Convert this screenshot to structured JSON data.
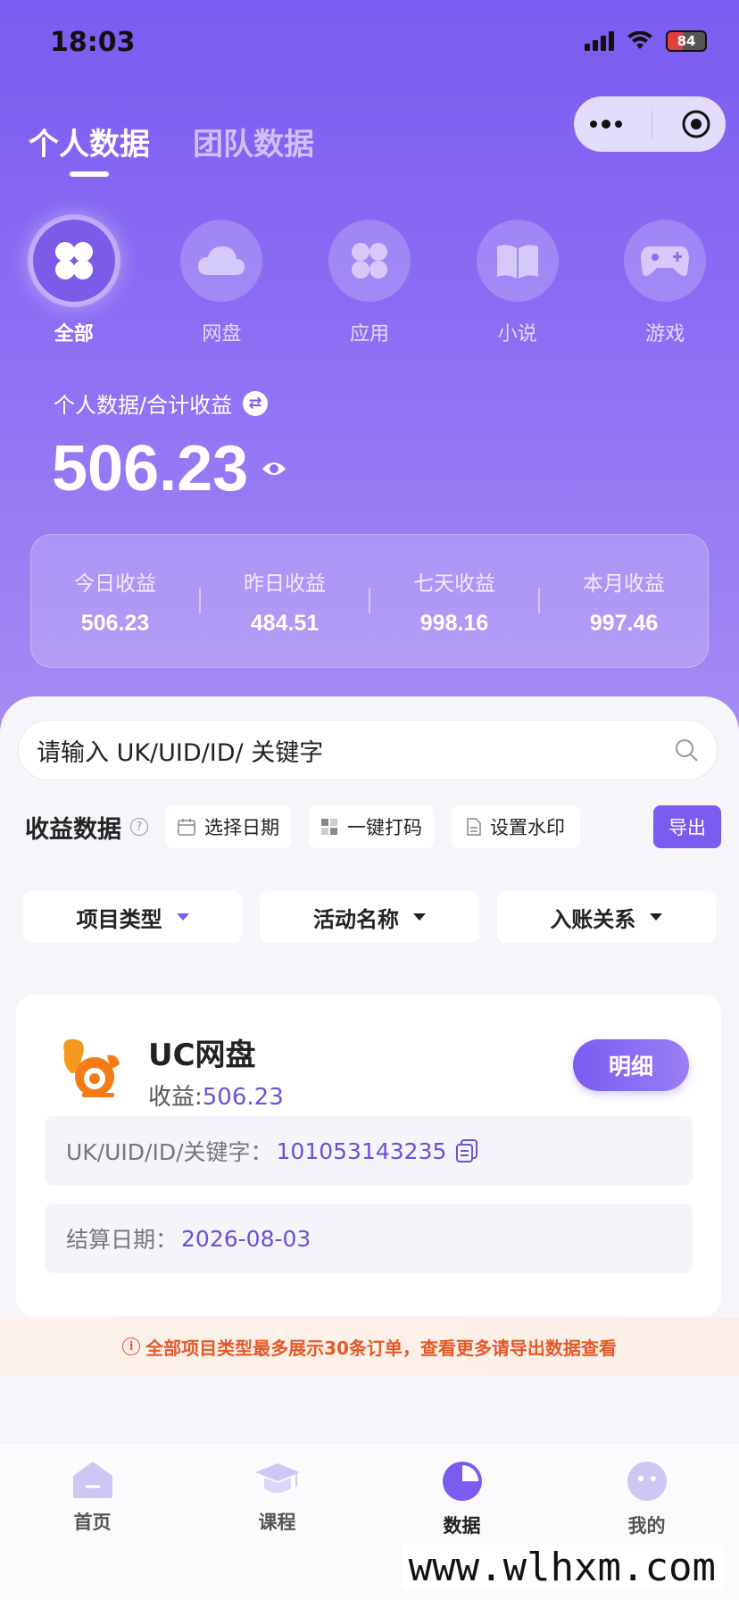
{
  "status_bar": {
    "time": "18:03",
    "battery": "84"
  },
  "tabs": {
    "personal": "个人数据",
    "team": "团队数据"
  },
  "categories": [
    {
      "label": "全部",
      "icon": "clover-icon"
    },
    {
      "label": "网盘",
      "icon": "cloud-icon"
    },
    {
      "label": "应用",
      "icon": "apps-icon"
    },
    {
      "label": "小说",
      "icon": "book-icon"
    },
    {
      "label": "游戏",
      "icon": "gamepad-icon"
    }
  ],
  "summary": {
    "label": "个人数据/合计收益",
    "total": "506.23"
  },
  "stats": [
    {
      "label": "今日收益",
      "value": "506.23"
    },
    {
      "label": "昨日收益",
      "value": "484.51"
    },
    {
      "label": "七天收益",
      "value": "998.16"
    },
    {
      "label": "本月收益",
      "value": "997.46"
    }
  ],
  "search": {
    "placeholder": "请输入 UK/UID/ID/ 关键字"
  },
  "toolbar": {
    "title": "收益数据",
    "select_date": "选择日期",
    "mask": "一键打码",
    "watermark": "设置水印",
    "export": "导出"
  },
  "filters": [
    {
      "label": "项目类型"
    },
    {
      "label": "活动名称"
    },
    {
      "label": "入账关系"
    }
  ],
  "card": {
    "name": "UC网盘",
    "income_label": "收益:",
    "income_value": "506.23",
    "detail": "明细",
    "uid_label": "UK/UID/ID/关键字：",
    "uid_value": "101053143235",
    "date_label": "结算日期：",
    "date_value": "2026-08-03"
  },
  "notice": "全部项目类型最多展示30条订单，查看更多请导出数据查看",
  "nav": [
    {
      "label": "首页"
    },
    {
      "label": "课程"
    },
    {
      "label": "数据"
    },
    {
      "label": "我的"
    }
  ],
  "watermark": "www.wlhxm.com",
  "colors": {
    "accent": "#7a5cf0",
    "income": "#6a52d8",
    "notice": "#e45a2a"
  }
}
